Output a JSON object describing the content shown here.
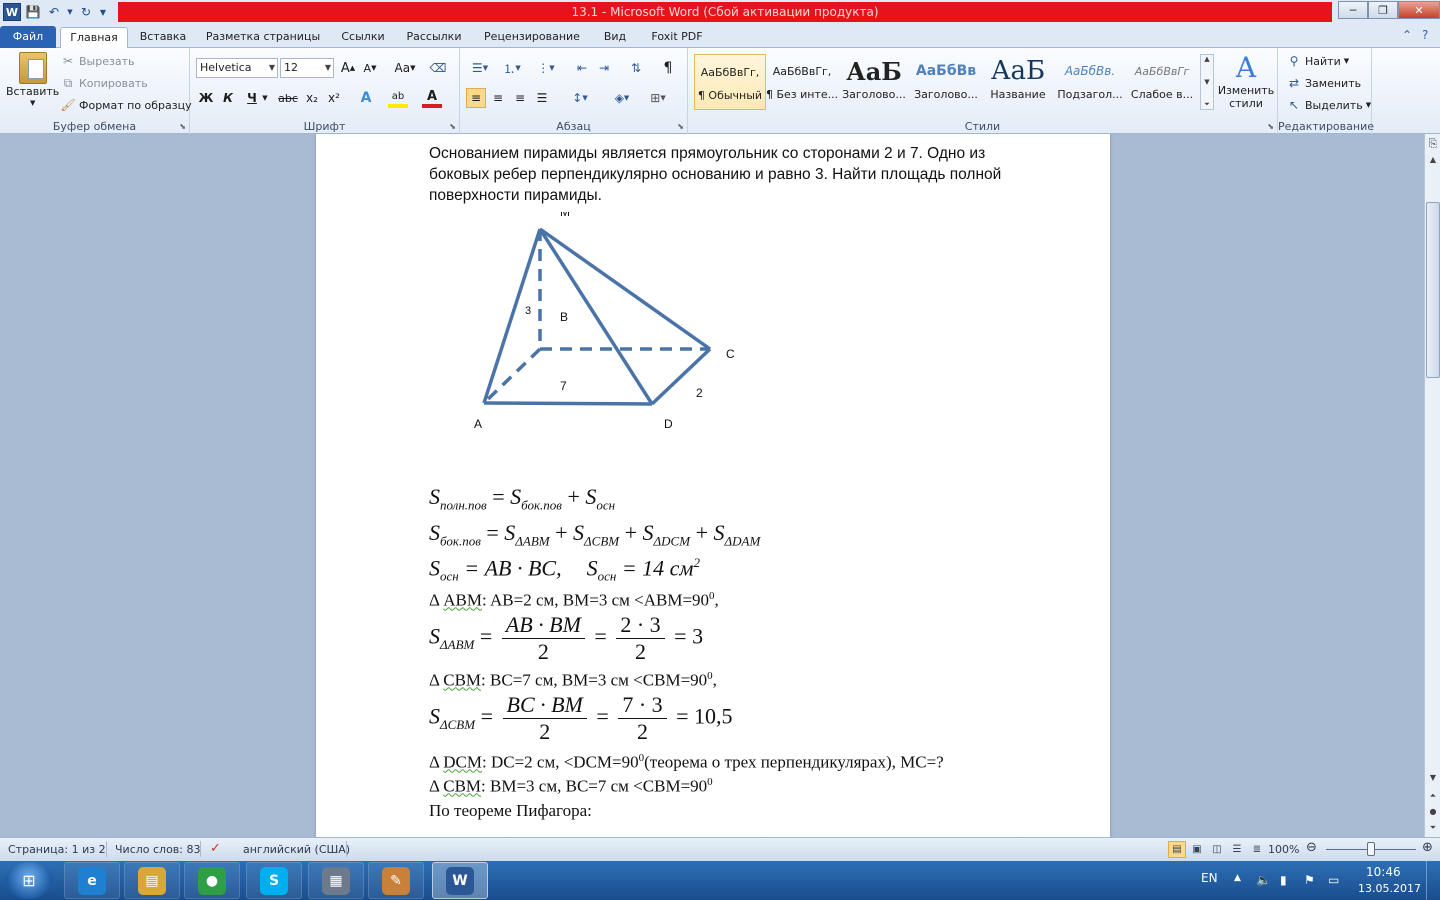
{
  "window": {
    "title": "13.1  -  Microsoft Word (Сбой активации продукта)",
    "min_glyph": "─",
    "max_glyph": "❐",
    "close_glyph": "✕"
  },
  "quick_access": {
    "word_logo": "W"
  },
  "tabs": [
    "Файл",
    "Главная",
    "Вставка",
    "Разметка страницы",
    "Ссылки",
    "Рассылки",
    "Рецензирование",
    "Вид",
    "Foxit PDF"
  ],
  "ribbon": {
    "clipboard": {
      "label": "Буфер обмена",
      "paste": "Вставить",
      "cut": "Вырезать",
      "copy": "Копировать",
      "format_painter": "Формат по образцу"
    },
    "font": {
      "label": "Шрифт",
      "font_name": "Helvetica",
      "font_size": "12",
      "grow": "A",
      "shrink": "A",
      "case": "Aa",
      "bold": "Ж",
      "italic": "К",
      "underline": "Ч",
      "strike": "abc",
      "sub": "x₂",
      "sup": "x²",
      "effects": "A",
      "highlight": "ab",
      "color": "A"
    },
    "paragraph": {
      "label": "Абзац",
      "pilcrow": "¶"
    },
    "styles": {
      "label": "Стили",
      "items": [
        {
          "preview": "АаБбВвГг,",
          "name": "¶ Обычный"
        },
        {
          "preview": "АаБбВвГг,",
          "name": "¶ Без инте..."
        },
        {
          "preview": "АаБ",
          "name": "Заголово..."
        },
        {
          "preview": "АаБбВв",
          "name": "Заголово..."
        },
        {
          "preview": "АаБ",
          "name": "Название"
        },
        {
          "preview": "АаБбВв.",
          "name": "Подзагол..."
        },
        {
          "preview": "АаБбВвГг",
          "name": "Слабое в..."
        }
      ],
      "change_styles": "Изменить стили"
    },
    "editing": {
      "label": "Редактирование",
      "find": "Найти",
      "replace": "Заменить",
      "select": "Выделить"
    }
  },
  "document": {
    "problem_text": "Основанием пирамиды является прямоугольник со сторонами 2 и 7. Одно из боковых ребер перпендикулярно основанию и равно 3. Найти площадь полной поверхности пирамиды.",
    "figure_labels": {
      "M": "M",
      "B": "B",
      "C": "C",
      "A": "A",
      "D": "D",
      "edge_3": "3",
      "edge_7": "7",
      "edge_2": "2"
    },
    "lines": {
      "l1": {
        "lhs": "S",
        "lhs_sub": "полн.пов",
        "eq": " = ",
        "t1": "S",
        "t1_sub": "бок.пов",
        "plus": " + ",
        "t2": "S",
        "t2_sub": "осн"
      },
      "l2": {
        "lhs": "S",
        "lhs_sub": "бок.пов",
        "eq": " = ",
        "t1": "S",
        "t1_sub": "ΔABM",
        "t2": "S",
        "t2_sub": "ΔCBM",
        "t3": "S",
        "t3_sub": "ΔDCM",
        "t4": "S",
        "t4_sub": "ΔDAM",
        "plus": " + "
      },
      "l3": {
        "a": "S",
        "a_sub": "осн",
        "a_rhs": " = AB · BC,",
        "b": "S",
        "b_sub": "осн",
        "b_rhs": " = 14 см",
        "b_sup": "2"
      },
      "l4": {
        "prefix": "Δ ",
        "name": "ABM",
        "rest": ": AB=2 см, BM=3 см <ABM=90",
        "sup": "0",
        "tail": ","
      },
      "l5": {
        "lhs": "S",
        "lhs_sub": "ΔABM",
        "eq": " = ",
        "num1": "AB · BM",
        "den1": "2",
        "eq2": "=",
        "num2": "2 · 3",
        "den2": "2",
        "res": "= 3"
      },
      "l6": {
        "prefix": "Δ ",
        "name": "CBM",
        "rest": ": BC=7 см, BM=3 см <CBM=90",
        "sup": "0",
        "tail": ","
      },
      "l7": {
        "lhs": "S",
        "lhs_sub": "ΔCBM",
        "eq": " = ",
        "num1": "BC · BM",
        "den1": "2",
        "eq2": "=",
        "num2": "7 · 3",
        "den2": "2",
        "res": "= 10,5"
      },
      "l8": {
        "prefix": "Δ ",
        "name": "DCM",
        "rest": ": DC=2 см, <DCM=90",
        "sup": "0",
        "tail": "(теорема о трех перпендикулярах), MC=?"
      },
      "l9": {
        "prefix": "Δ ",
        "name": "CBM",
        "rest": ": BM=3 см, BC=7 см <CBM=90",
        "sup": "0",
        "tail": ""
      },
      "l10": {
        "text": "По теореме Пифагора:"
      }
    }
  },
  "statusbar": {
    "page": "Страница: 1 из 2",
    "words": "Число слов: 83",
    "language": "английский (США)",
    "zoom": "100%",
    "zoom_level": 0.5
  },
  "taskbar": {
    "lang": "EN",
    "time": "10:46",
    "date": "13.05.2017",
    "apps": [
      {
        "key": "ie",
        "glyph": "e",
        "color": "#1f7fd1"
      },
      {
        "key": "explorer",
        "glyph": "▤",
        "color": "#d9a63a"
      },
      {
        "key": "chrome",
        "glyph": "●",
        "color": "#2e9e47"
      },
      {
        "key": "skype",
        "glyph": "S",
        "color": "#00aff0"
      },
      {
        "key": "calculator",
        "glyph": "▦",
        "color": "#6c7a8c"
      },
      {
        "key": "paint",
        "glyph": "✎",
        "color": "#c9813a"
      },
      {
        "key": "word",
        "glyph": "W",
        "color": "#2b5797"
      }
    ]
  }
}
